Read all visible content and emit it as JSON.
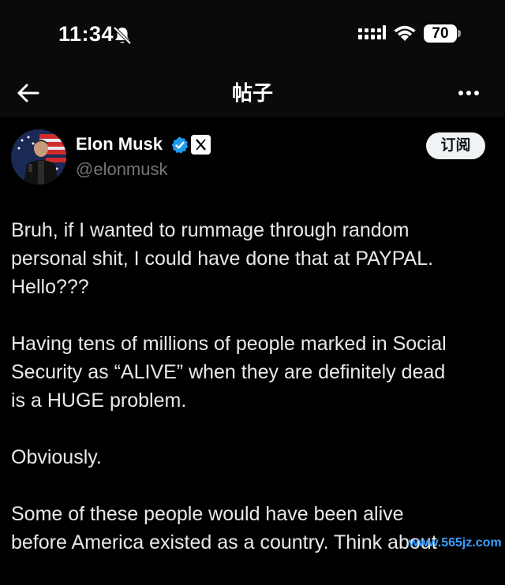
{
  "status_bar": {
    "time": "11:34",
    "battery_level": "70",
    "icons": [
      "bell-slash-icon",
      "signal-icon",
      "wifi-icon",
      "battery-icon"
    ]
  },
  "header": {
    "title": "帖子",
    "icons": [
      "back-arrow-icon",
      "more-options-icon"
    ]
  },
  "post": {
    "author": {
      "name": "Elon Musk",
      "handle": "@elonmusk",
      "verified": true,
      "affiliation": "X"
    },
    "subscribe_label": "订阅",
    "paragraphs": [
      "Bruh, if I wanted to rummage through random\npersonal shit, I could have done that at PAYPAL.\nHello???",
      "Having tens of millions of people marked in Social\nSecurity as “ALIVE” when they are definitely dead\nis a HUGE problem.",
      "Obviously.",
      "Some of these people would have been alive\nbefore America existed as a country. Think about"
    ]
  },
  "colors": {
    "background": "#000000",
    "text": "#e7e9ea",
    "secondary_text": "#71767b",
    "verified_blue": "#1d9bf0",
    "watermark": "#3aa0ff"
  },
  "watermark": {
    "text": "www.565jz.com"
  }
}
